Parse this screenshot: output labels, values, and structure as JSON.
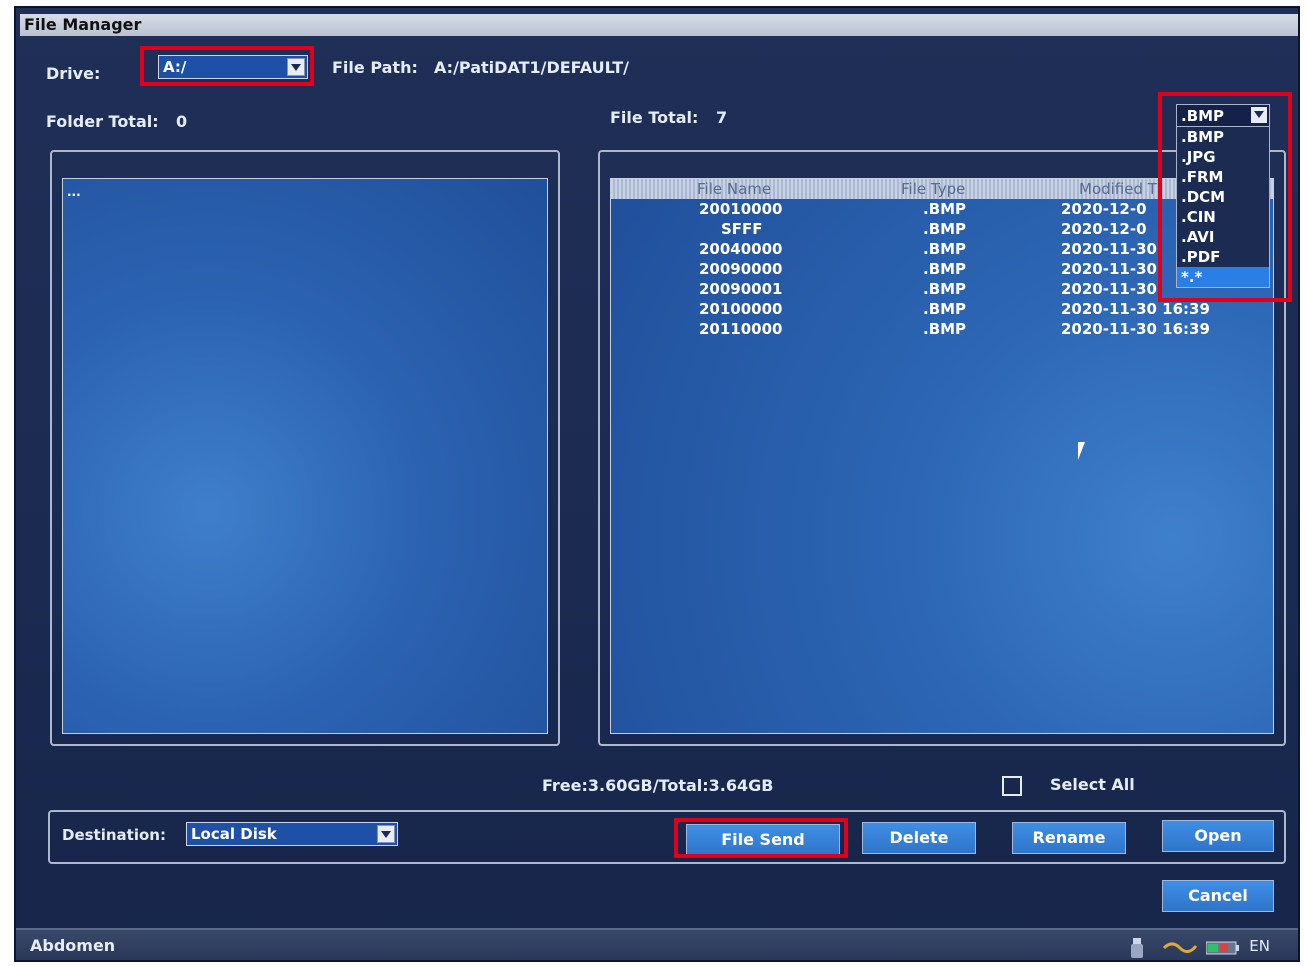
{
  "window": {
    "title": "File Manager"
  },
  "drive": {
    "label": "Drive:",
    "value": "A:/"
  },
  "file_path": {
    "label": "File Path:",
    "value": "A:/PatiDAT1/DEFAULT/"
  },
  "folder_total": {
    "label": "Folder Total:",
    "value": "0"
  },
  "file_total": {
    "label": "File Total:",
    "value": "7"
  },
  "folder_list": {
    "items": [
      "..."
    ]
  },
  "file_table": {
    "columns": [
      "File Name",
      "File Type",
      "Modified T"
    ],
    "rows": [
      {
        "name": "20010000",
        "type": ".BMP",
        "modified": "2020-12-0"
      },
      {
        "name": "SFFF",
        "type": ".BMP",
        "modified": "2020-12-0"
      },
      {
        "name": "20040000",
        "type": ".BMP",
        "modified": "2020-11-30"
      },
      {
        "name": "20090000",
        "type": ".BMP",
        "modified": "2020-11-30"
      },
      {
        "name": "20090001",
        "type": ".BMP",
        "modified": "2020-11-30"
      },
      {
        "name": "20100000",
        "type": ".BMP",
        "modified": "2020-11-30 16:39"
      },
      {
        "name": "20110000",
        "type": ".BMP",
        "modified": "2020-11-30 16:39"
      }
    ]
  },
  "filter": {
    "selected": ".BMP",
    "options": [
      ".BMP",
      ".JPG",
      ".FRM",
      ".DCM",
      ".CIN",
      ".AVI",
      ".PDF",
      "*.*"
    ],
    "highlighted": "*.*"
  },
  "storage": {
    "text": "Free:3.60GB/Total:3.64GB"
  },
  "select_all": {
    "label": "Select  All",
    "checked": false
  },
  "destination": {
    "label": "Destination:",
    "value": "Local  Disk"
  },
  "buttons": {
    "file_send": "File  Send",
    "delete": "Delete",
    "rename": "Rename",
    "open": "Open",
    "cancel": "Cancel"
  },
  "statusbar": {
    "mode": "Abdomen",
    "language": "EN"
  },
  "colors": {
    "highlight_box": "#e1001c",
    "button": "#3f8ee6",
    "panel": "#2b63b2"
  }
}
